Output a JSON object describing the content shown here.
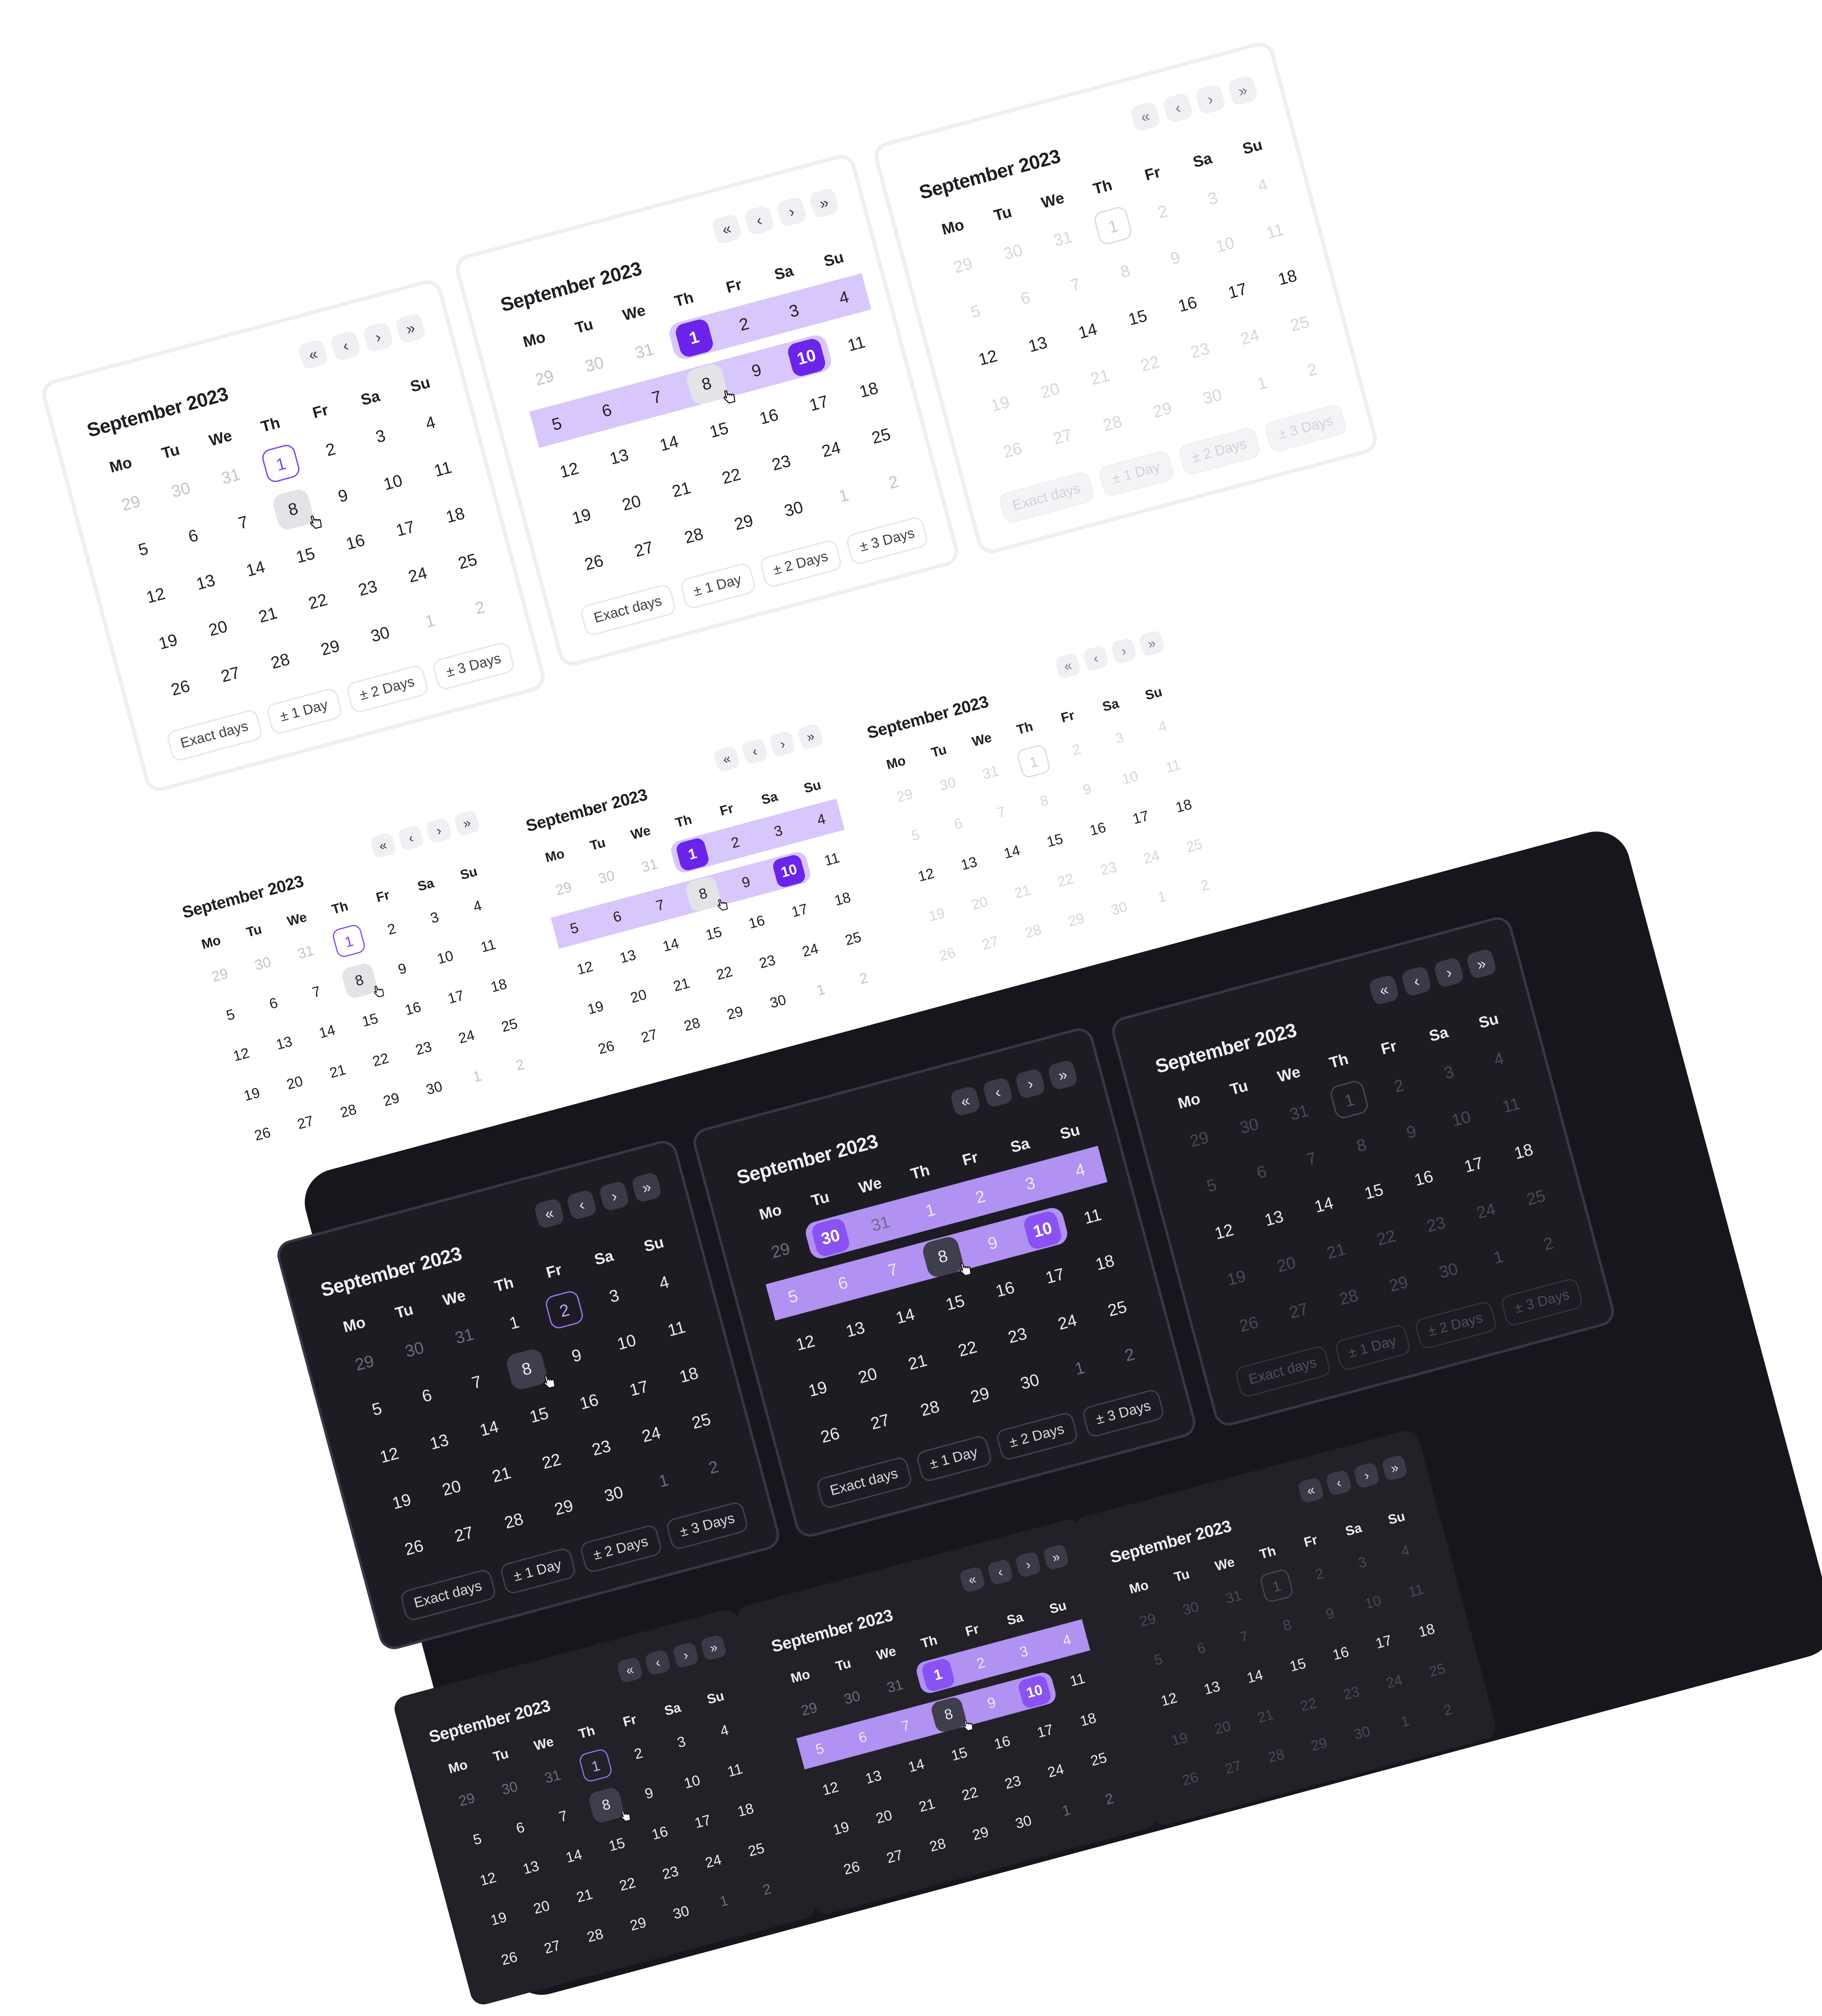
{
  "month_title": "September 2023",
  "weekdays": [
    "Mo",
    "Tu",
    "We",
    "Th",
    "Fr",
    "Sa",
    "Su"
  ],
  "nav_icons": [
    "double-chevron-left-icon",
    "chevron-left-icon",
    "chevron-right-icon",
    "double-chevron-right-icon"
  ],
  "nav_glyphs": [
    "«",
    "‹",
    "›",
    "»"
  ],
  "footer_buttons": [
    "Exact days",
    "± 1 Day",
    "± 2 Days",
    "± 3 Days"
  ],
  "colors": {
    "accent": "#6b24ea",
    "range_light": "#d8c7fb",
    "range_dark": "#b191f2",
    "dark_background": "#17161c"
  },
  "weeks": [
    [
      "29",
      "30",
      "31",
      "1",
      "2",
      "3",
      "4"
    ],
    [
      "5",
      "6",
      "7",
      "8",
      "9",
      "10",
      "11"
    ],
    [
      "12",
      "13",
      "14",
      "15",
      "16",
      "17",
      "18"
    ],
    [
      "19",
      "20",
      "21",
      "22",
      "23",
      "24",
      "25"
    ],
    [
      "26",
      "27",
      "28",
      "29",
      "30",
      "1",
      "2"
    ]
  ],
  "weeks_grid": [
    [
      "29",
      "30",
      "31",
      "1",
      "2",
      "3",
      "4"
    ],
    [
      "29",
      "30",
      "31",
      "1",
      "2",
      "3",
      "4"
    ],
    [
      "5",
      "6",
      "7",
      "8",
      "9",
      "10",
      "11"
    ],
    [
      "12",
      "13",
      "14",
      "15",
      "16",
      "17",
      "18"
    ],
    [
      "19",
      "20",
      "21",
      "22",
      "23",
      "24",
      "25"
    ],
    [
      "26",
      "27",
      "28",
      "29",
      "30",
      "1",
      "2"
    ]
  ],
  "weeks_dark_single": [
    [
      "29",
      "30",
      "31",
      "1",
      "2",
      "3",
      "4"
    ],
    [
      "5",
      "6",
      "7",
      "8",
      "9",
      "10",
      "11"
    ],
    [
      "12",
      "13",
      "14",
      "15",
      "16",
      "17",
      "18"
    ],
    [
      "19",
      "20",
      "21",
      "22",
      "23",
      "24",
      "25"
    ],
    [
      "26",
      "27",
      "28",
      "29",
      "30",
      "1",
      "2"
    ]
  ],
  "weeks_dark_range": [
    [
      "29",
      "30",
      "31",
      "1",
      "2",
      "3",
      "4"
    ],
    [
      "5",
      "6",
      "7",
      "8",
      "9",
      "10",
      "11"
    ],
    [
      "12",
      "13",
      "14",
      "15",
      "16",
      "17",
      "18"
    ],
    [
      "19",
      "20",
      "21",
      "22",
      "23",
      "24",
      "25"
    ],
    [
      "26",
      "27",
      "28",
      "29",
      "30",
      "1",
      "2"
    ]
  ],
  "dark_single_first_week": [
    "29",
    "30",
    "31",
    "1",
    "2",
    "3",
    "4"
  ],
  "dark_single_today": "2",
  "dark_range_first_week": [
    "29",
    "30",
    "31",
    "1",
    "2",
    "3",
    "4"
  ],
  "dark_range_start": "30",
  "calendars": [
    {
      "id": "light-single-framed",
      "theme": "light",
      "state": "single",
      "framed": true,
      "today": "1",
      "hover": "8"
    },
    {
      "id": "light-range-framed",
      "theme": "light",
      "state": "range",
      "framed": true,
      "range_start": "1",
      "range_end": "10",
      "hover": "8"
    },
    {
      "id": "light-disabled-framed",
      "theme": "light",
      "state": "disabled",
      "framed": true,
      "today": "1",
      "enabled_from": "12",
      "enabled_to": "18"
    },
    {
      "id": "light-single-compact",
      "theme": "light",
      "state": "single",
      "framed": false,
      "today": "1",
      "hover": "8"
    },
    {
      "id": "light-range-compact",
      "theme": "light",
      "state": "range",
      "framed": false,
      "range_start": "1",
      "range_end": "10",
      "hover": "8"
    },
    {
      "id": "light-disabled-compact",
      "theme": "light",
      "state": "disabled",
      "framed": false,
      "today": "1"
    },
    {
      "id": "dark-single-framed",
      "theme": "dark",
      "state": "single",
      "framed": true,
      "today": "2",
      "hover": "8"
    },
    {
      "id": "dark-range-framed",
      "theme": "dark",
      "state": "range",
      "framed": true,
      "range_start": "30",
      "range_end": "10",
      "hover": "8"
    },
    {
      "id": "dark-disabled-framed",
      "theme": "dark",
      "state": "disabled",
      "framed": true,
      "today": "1"
    },
    {
      "id": "dark-single-compact",
      "theme": "dark",
      "state": "single",
      "framed": false,
      "today": "1",
      "hover": "8"
    },
    {
      "id": "dark-range-compact",
      "theme": "dark",
      "state": "range",
      "framed": false,
      "range_start": "1",
      "range_end": "10",
      "hover": "8"
    },
    {
      "id": "dark-disabled-compact",
      "theme": "dark",
      "state": "disabled",
      "framed": false,
      "today": "1"
    }
  ]
}
